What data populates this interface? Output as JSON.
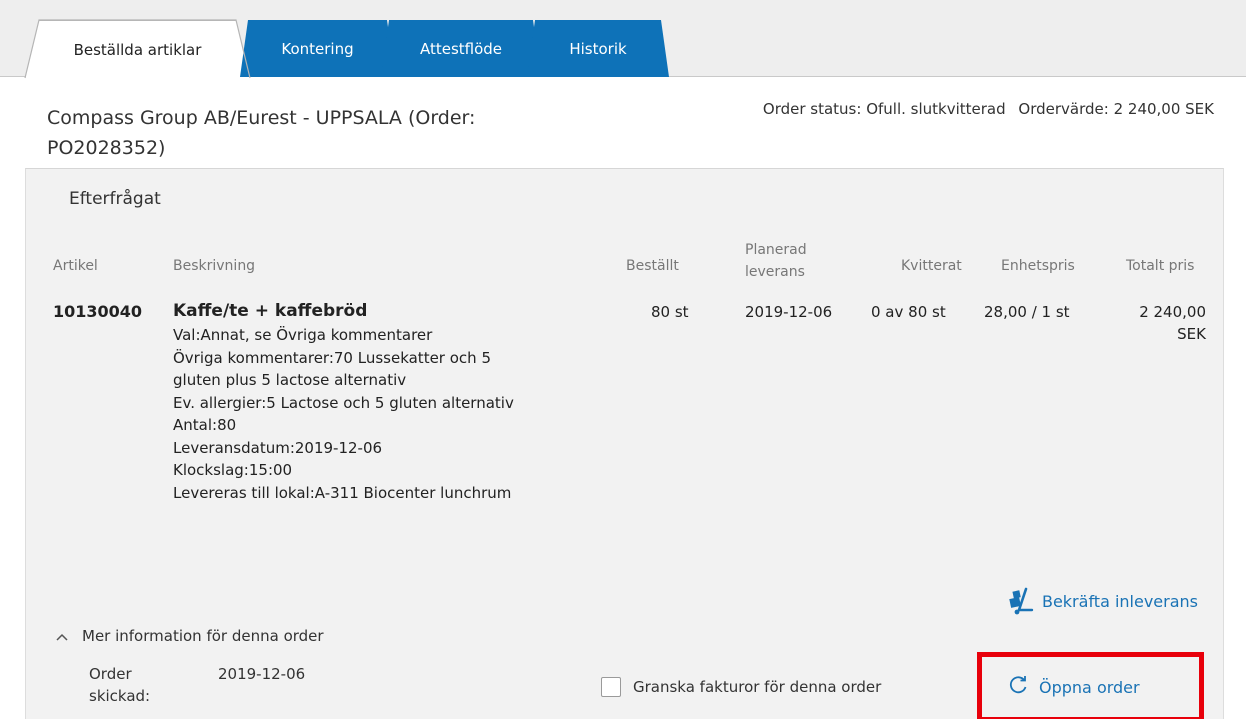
{
  "tabs": [
    {
      "label": "Beställda artiklar",
      "active": true
    },
    {
      "label": "Kontering",
      "active": false
    },
    {
      "label": "Attestflöde",
      "active": false
    },
    {
      "label": "Historik",
      "active": false
    }
  ],
  "header": {
    "title": "Compass Group AB/Eurest - UPPSALA (Order: PO2028352)",
    "order_status": "Order status: Ofull. slutkvitterad",
    "order_value": "Ordervärde: 2 240,00 SEK"
  },
  "section": {
    "title": "Efterfrågat"
  },
  "table": {
    "headers": {
      "artikel": "Artikel",
      "beskrivning": "Beskrivning",
      "bestallt": "Beställt",
      "planerad_line1": "Planerad",
      "planerad_line2": "leverans",
      "kvitterat": "Kvitterat",
      "enhetspris": "Enhetspris",
      "totalt_pris": "Totalt pris"
    },
    "rows": [
      {
        "artikel": "10130040",
        "title": "Kaffe/te + kaffebröd",
        "lines": [
          "Val:Annat, se Övriga kommentarer",
          "Övriga kommentarer:70 Lussekatter och 5",
          "gluten plus 5 lactose alternativ",
          "Ev. allergier:5 Lactose och 5 gluten alternativ",
          "Antal:80",
          "Leveransdatum:2019-12-06",
          "Klockslag:15:00",
          "Levereras till lokal:A-311 Biocenter lunchrum"
        ],
        "bestallt": "80 st",
        "planerad_leverans": "2019-12-06",
        "kvitterat": "0 av 80 st",
        "enhetspris": "28,00 / 1 st",
        "totalt_pris_amount": "2 240,00",
        "totalt_pris_currency": "SEK"
      }
    ]
  },
  "actions": {
    "confirm_delivery": "Bekräfta inleverans",
    "more_info": "Mer information för denna order",
    "order_sent_label": "Order skickad:",
    "order_sent_value": "2019-12-06",
    "review_invoices": "Granska fakturor för denna order",
    "open_order": "Öppna order"
  },
  "colors": {
    "tab_blue": "#0e72b8",
    "link_blue": "#1a73b5",
    "highlight_red": "#e8000b",
    "panel_bg": "#f2f2f2"
  },
  "icons": {
    "confirm_delivery": "hand-truck-icon",
    "more_info": "chevron-up-icon",
    "open_order": "refresh-icon"
  }
}
